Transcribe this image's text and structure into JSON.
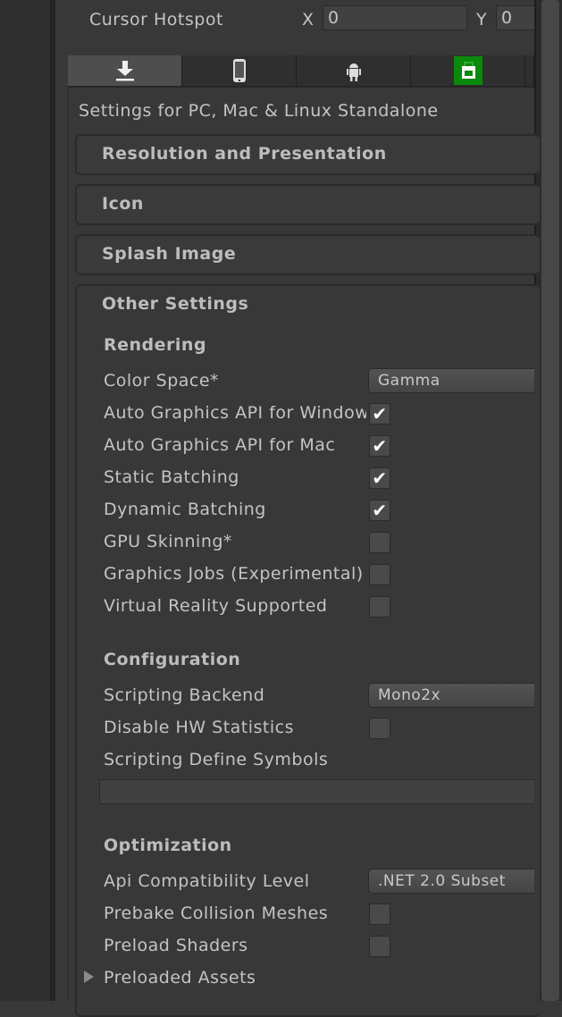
{
  "cursor_hotspot": {
    "label": "Cursor Hotspot",
    "x_label": "X",
    "x_value": "0",
    "y_label": "Y",
    "y_value": "0"
  },
  "platform_tabs": [
    {
      "icon": "download-icon",
      "active": true
    },
    {
      "icon": "phone-icon"
    },
    {
      "icon": "android-icon"
    },
    {
      "icon": "windows-store-icon",
      "color": "#0a8a0a"
    }
  ],
  "settings_for": "Settings for PC, Mac & Linux Standalone",
  "sections": [
    "Resolution and Presentation",
    "Icon",
    "Splash Image"
  ],
  "other_settings": {
    "title": "Other Settings",
    "rendering": {
      "title": "Rendering",
      "color_space": {
        "label": "Color Space*",
        "value": "Gamma"
      },
      "checks": [
        {
          "label": "Auto Graphics API for Windows",
          "checked": true
        },
        {
          "label": "Auto Graphics API for Mac",
          "checked": true
        },
        {
          "label": "Static Batching",
          "checked": true
        },
        {
          "label": "Dynamic Batching",
          "checked": true
        },
        {
          "label": "GPU Skinning*",
          "checked": false
        },
        {
          "label": "Graphics Jobs (Experimental)",
          "checked": false
        },
        {
          "label": "Virtual Reality Supported",
          "checked": false
        }
      ]
    },
    "configuration": {
      "title": "Configuration",
      "scripting_backend": {
        "label": "Scripting Backend",
        "value": "Mono2x"
      },
      "disable_hw": {
        "label": "Disable HW Statistics",
        "checked": false
      },
      "define_symbols": {
        "label": "Scripting Define Symbols",
        "value": ""
      }
    },
    "optimization": {
      "title": "Optimization",
      "api_level": {
        "label": "Api Compatibility Level",
        "value": ".NET 2.0 Subset"
      },
      "prebake": {
        "label": "Prebake Collision Meshes",
        "checked": false
      },
      "preload_shaders": {
        "label": "Preload Shaders",
        "checked": false
      },
      "preloaded_assets": {
        "label": "Preloaded Assets"
      }
    }
  },
  "check_mark": "✔"
}
